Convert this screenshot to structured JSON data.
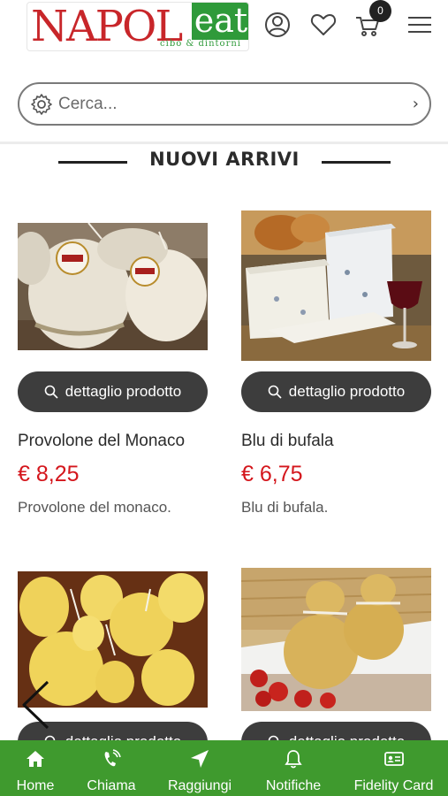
{
  "header": {
    "logo": {
      "part1": "NAPOL",
      "part2": "eat",
      "tagline": "cibo & dintorni"
    },
    "cart_count": "0",
    "icons": [
      "user-icon",
      "heart-icon",
      "cart-icon",
      "hamburger-menu-icon"
    ]
  },
  "search": {
    "placeholder": "Cerca...",
    "arrow": "›"
  },
  "section": {
    "title": "NUOVI ARRIVI"
  },
  "products": [
    {
      "name": "Provolone del Monaco",
      "price": "€ 8,25",
      "description": "Provolone del monaco.",
      "button": "dettaglio prodotto"
    },
    {
      "name": "Blu di bufala",
      "price": "€ 6,75",
      "description": "Blu di bufala.",
      "button": "dettaglio prodotto"
    },
    {
      "button": "dettaglio prodotto"
    },
    {
      "button": "dettaglio prodotto"
    }
  ],
  "bottom_nav": [
    {
      "label": "Home",
      "icon": "home-icon"
    },
    {
      "label": "Chiama",
      "icon": "phone-icon"
    },
    {
      "label": "Raggiungi",
      "icon": "location-arrow-icon"
    },
    {
      "label": "Notifiche",
      "icon": "bell-icon"
    },
    {
      "label": "Fidelity Card",
      "icon": "id-card-icon"
    }
  ],
  "colors": {
    "brand_red": "#c8262a",
    "brand_green": "#2f9a3a",
    "nav_green": "#3f9a2e",
    "price_red": "#d4161c",
    "button_dark": "#3d3d3d"
  }
}
